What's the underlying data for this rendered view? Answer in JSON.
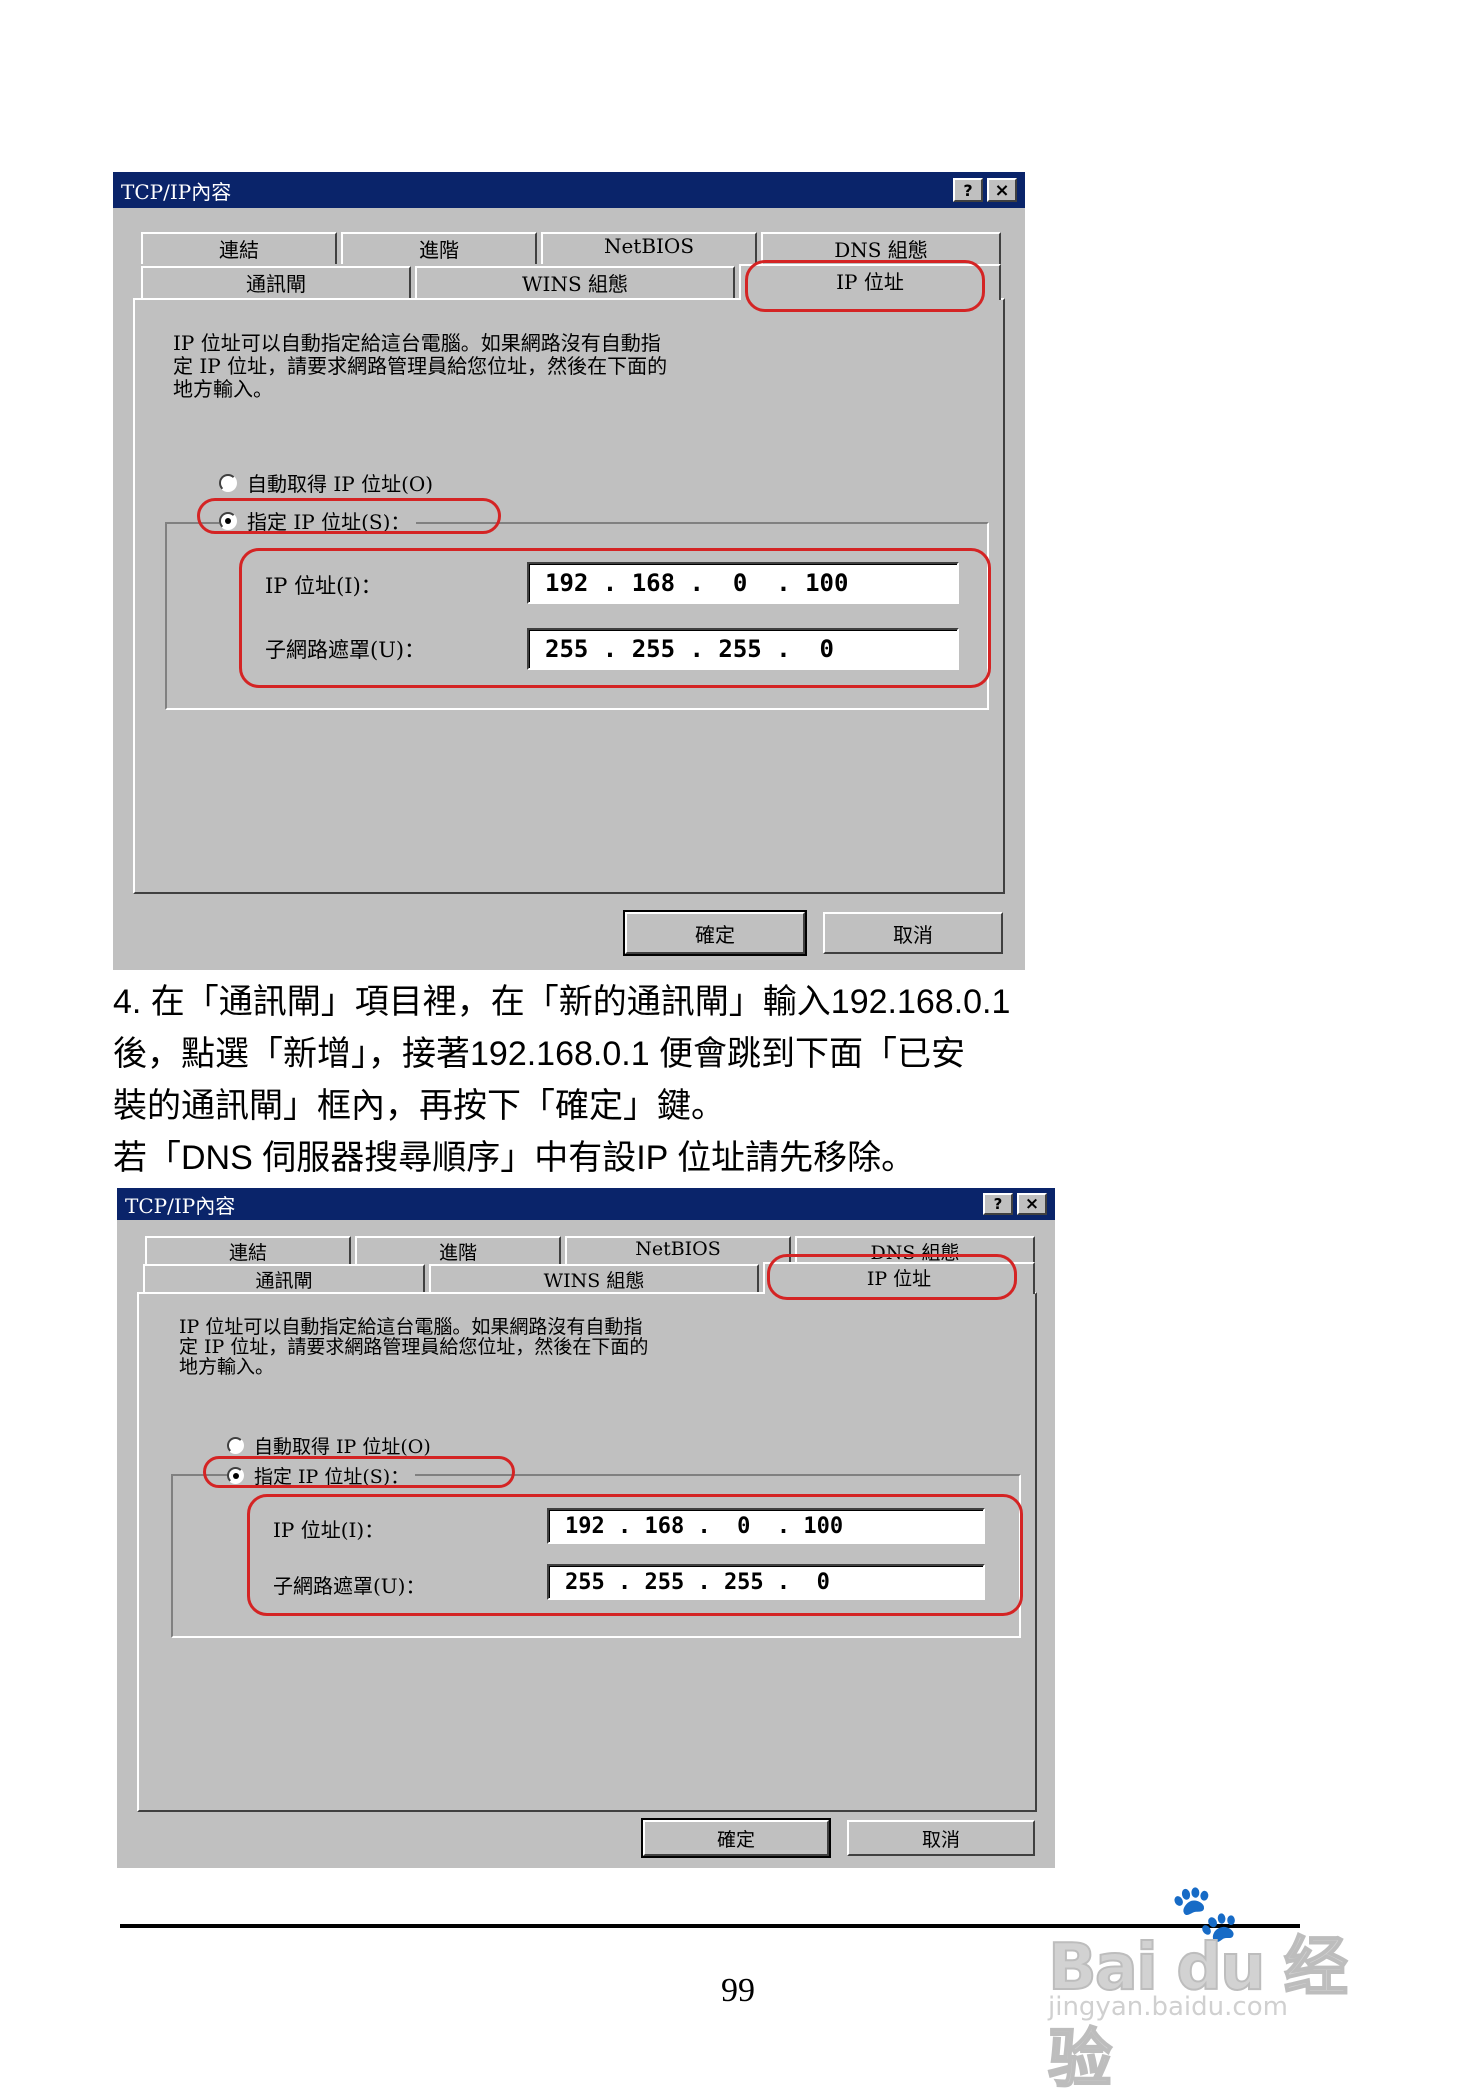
{
  "dialogs": [
    {
      "title": "TCP/IP內容",
      "help_button": "?",
      "close_button": "×",
      "tabs_back": [
        "連結",
        "進階",
        "NetBIOS",
        "DNS 組態"
      ],
      "tabs_front": [
        "通訊閘",
        "WINS 組態",
        "IP 位址"
      ],
      "active_tab": "IP 位址",
      "description": "IP 位址可以自動指定給這台電腦。如果網路沒有自動指\n定 IP 位址，請要求網路管理員給您位址，然後在下面的\n地方輸入。",
      "radio_auto": "自動取得 IP 位址(O)",
      "radio_manual": "指定 IP 位址(S)：",
      "ip_label": "IP 位址(I)：",
      "ip_value": "192 . 168 .  0  . 100",
      "mask_label": "子網路遮罩(U)：",
      "mask_value": "255 . 255 . 255 .  0",
      "ok_button": "確定",
      "cancel_button": "取消"
    },
    {
      "title": "TCP/IP內容",
      "help_button": "?",
      "close_button": "×",
      "tabs_back": [
        "連結",
        "進階",
        "NetBIOS",
        "DNS 組態"
      ],
      "tabs_front": [
        "通訊閘",
        "WINS 組態",
        "IP 位址"
      ],
      "active_tab": "IP 位址",
      "description": "IP 位址可以自動指定給這台電腦。如果網路沒有自動指\n定 IP 位址，請要求網路管理員給您位址，然後在下面的\n地方輸入。",
      "radio_auto": "自動取得 IP 位址(O)",
      "radio_manual": "指定 IP 位址(S)：",
      "ip_label": "IP 位址(I)：",
      "ip_value": "192 . 168 .  0  . 100",
      "mask_label": "子網路遮罩(U)：",
      "mask_value": "255 . 255 . 255 .  0",
      "ok_button": "確定",
      "cancel_button": "取消"
    }
  ],
  "instructions": {
    "line1": "4. 在「通訊閘」項目裡，在「新的通訊閘」輸入192.168.0.1",
    "line2": "後，點選「新增」，接著192.168.0.1 便會跳到下面「已安",
    "line3": "裝的通訊閘」框內，再按下「確定」鍵。",
    "line4": "若「DNS 伺服器搜尋順序」中有設IP 位址請先移除。"
  },
  "page_number": "99",
  "watermark": {
    "brand": "Bai du 经验",
    "url": "jingyan.baidu.com"
  },
  "colors": {
    "titlebar": "#0a246a",
    "dialog_bg": "#c0c0c0",
    "highlight": "#d42424"
  }
}
